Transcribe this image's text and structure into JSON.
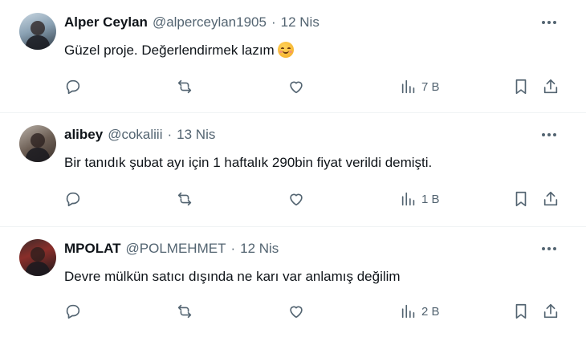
{
  "replies": [
    {
      "name": "Alper Ceylan",
      "handle": "@alperceylan1905",
      "separator": "·",
      "date": "12 Nis",
      "text": "Güzel proje. Değerlendirmek lazım",
      "emoji": "smiling-face-with-smiling-eyes",
      "views": "7 B"
    },
    {
      "name": "alibey",
      "handle": "@cokaliii",
      "separator": "·",
      "date": "13 Nis",
      "text": "Bir tanıdık şubat ayı için 1 haftalık 290bin fiyat verildi demişti.",
      "views": "1 B"
    },
    {
      "name": "MPOLAT",
      "handle": "@POLMEHMET",
      "separator": "·",
      "date": "12 Nis",
      "text": "Devre mülkün satıcı dışında ne karı var anlamış değilim",
      "views": "2 B"
    }
  ],
  "colors": {
    "text_primary": "#0f1419",
    "text_secondary": "#536471",
    "divider": "#eff3f4",
    "background": "#ffffff"
  }
}
